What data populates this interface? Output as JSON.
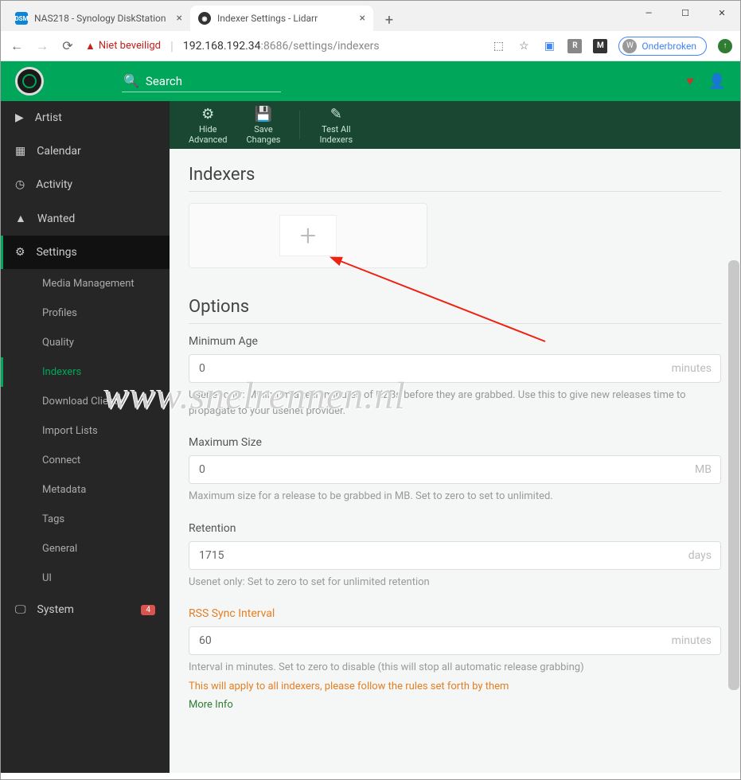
{
  "browser": {
    "tabs": [
      {
        "title": "NAS218 - Synology DiskStation",
        "icon_label": "DSM"
      },
      {
        "title": "Indexer Settings - Lidarr",
        "icon_label": "◉"
      }
    ],
    "not_secure": "Niet beveiligd",
    "url_host": "192.168.192.34",
    "url_rest": ":8686/settings/indexers",
    "ext_icons": [
      "R",
      "M"
    ],
    "user_initial": "W",
    "user_label": "Onderbroken"
  },
  "search": {
    "placeholder": "Search"
  },
  "toolbar": {
    "hide_advanced": "Hide\nAdvanced",
    "save_changes": "Save\nChanges",
    "test_all": "Test All\nIndexers"
  },
  "sidebar": {
    "items": [
      {
        "label": "Artist"
      },
      {
        "label": "Calendar"
      },
      {
        "label": "Activity"
      },
      {
        "label": "Wanted"
      },
      {
        "label": "Settings"
      },
      {
        "label": "System"
      }
    ],
    "sub": [
      {
        "label": "Media Management"
      },
      {
        "label": "Profiles"
      },
      {
        "label": "Quality"
      },
      {
        "label": "Indexers"
      },
      {
        "label": "Download Clients"
      },
      {
        "label": "Import Lists"
      },
      {
        "label": "Connect"
      },
      {
        "label": "Metadata"
      },
      {
        "label": "Tags"
      },
      {
        "label": "General"
      },
      {
        "label": "UI"
      }
    ],
    "system_badge": "4"
  },
  "content": {
    "title_indexers": "Indexers",
    "title_options": "Options",
    "fields": {
      "min_age": {
        "label": "Minimum Age",
        "value": "0",
        "suffix": "minutes",
        "help": "Usenet only: Minimum age in minutes of NZBs before they are grabbed. Use this to give new releases time to propagate to your usenet provider."
      },
      "max_size": {
        "label": "Maximum Size",
        "value": "0",
        "suffix": "MB",
        "help": "Maximum size for a release to be grabbed in MB. Set to zero to set to unlimited."
      },
      "retention": {
        "label": "Retention",
        "value": "1715",
        "suffix": "days",
        "help": "Usenet only: Set to zero to set for unlimited retention"
      },
      "rss": {
        "label": "RSS Sync Interval",
        "value": "60",
        "suffix": "minutes",
        "help": "Interval in minutes. Set to zero to disable (this will stop all automatic release grabbing)",
        "warn": "This will apply to all indexers, please follow the rules set forth by them",
        "more": "More Info"
      }
    }
  },
  "watermark": "www.snelrennen.nl"
}
